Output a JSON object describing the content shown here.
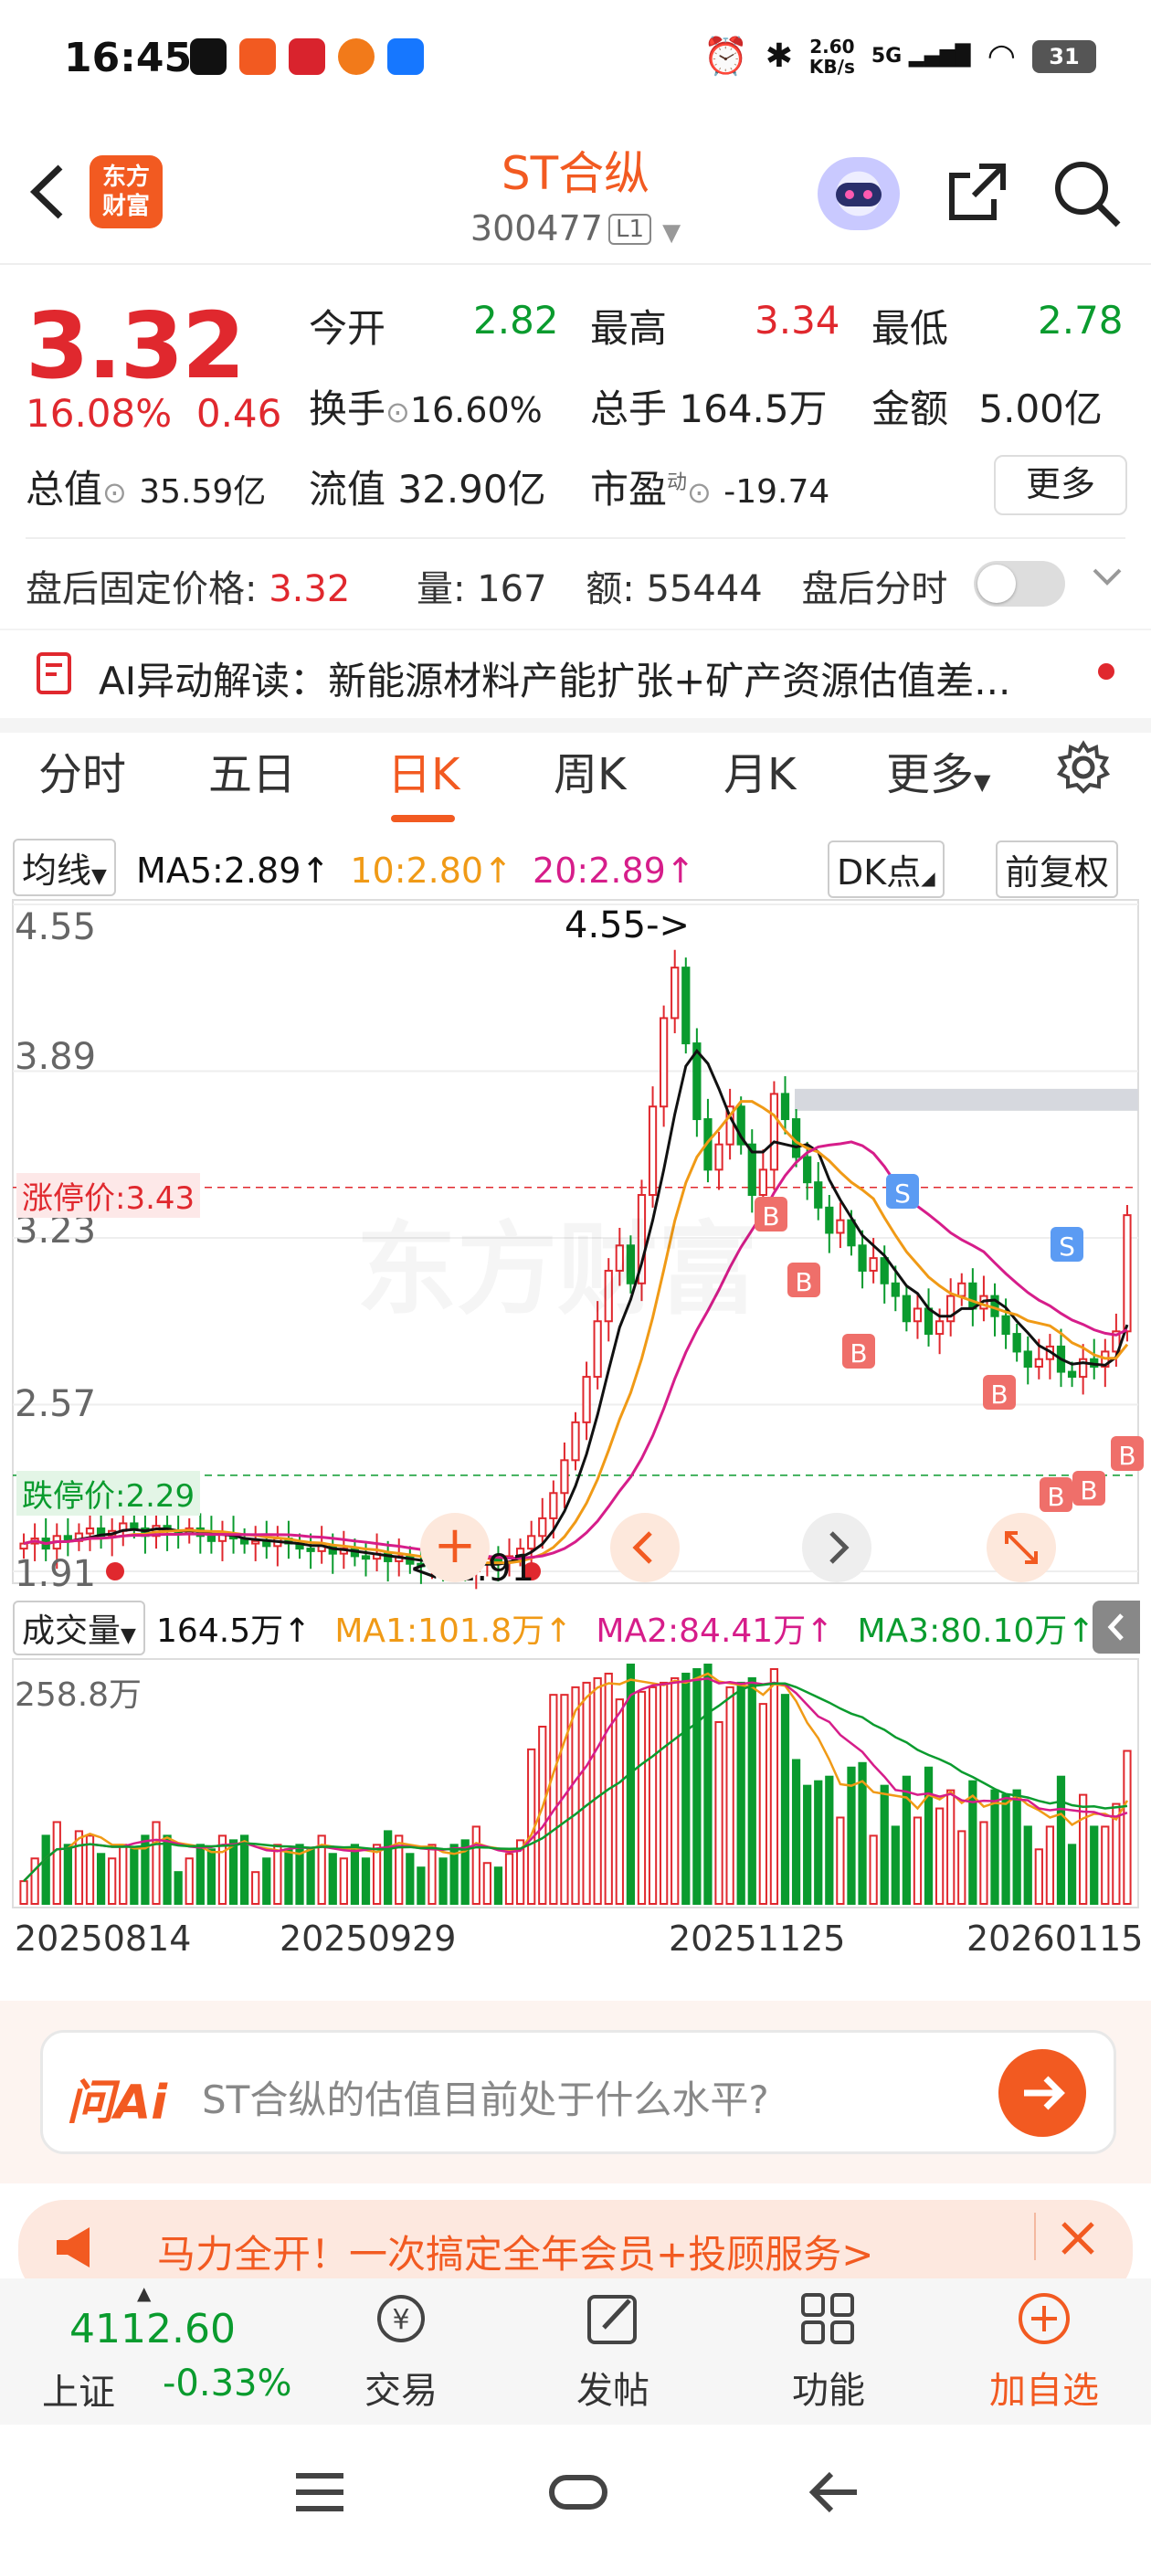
{
  "status_bar": {
    "time": "16:45",
    "net_speed_value": "2.60",
    "net_speed_unit": "KB/s",
    "signal": "5G",
    "battery": "31"
  },
  "header": {
    "logo_line1": "东方",
    "logo_line2": "财富",
    "title": "ST合纵",
    "code": "300477",
    "code_badge": "L1"
  },
  "quote": {
    "price": "3.32",
    "change_pct": "16.08%",
    "change_amt": "0.46",
    "open_label": "今开",
    "open": "2.82",
    "high_label": "最高",
    "high": "3.34",
    "low_label": "最低",
    "low": "2.78",
    "turnover_label": "换手",
    "turnover": "16.60%",
    "volume_label": "总手",
    "volume": "164.5万",
    "amount_label": "金额",
    "amount": "5.00亿",
    "mktcap_label": "总值",
    "mktcap": "35.59亿",
    "float_label": "流值",
    "float_cap": "32.90亿",
    "pe_label": "市盈",
    "pe_sup": "动",
    "pe": "-19.74",
    "more_label": "更多"
  },
  "after_hours": {
    "label": "盘后固定价格:",
    "price": "3.32",
    "vol_label": "量:",
    "vol": "167",
    "amt_label": "额:",
    "amt": "55444",
    "timeshare_label": "盘后分时"
  },
  "ai_news": {
    "text": "AI异动解读：新能源材料产能扩张+矿产资源估值差..."
  },
  "tabs": [
    {
      "label": "分时"
    },
    {
      "label": "五日"
    },
    {
      "label": "日K"
    },
    {
      "label": "周K"
    },
    {
      "label": "月K"
    },
    {
      "label": "更多"
    }
  ],
  "ma_row": {
    "selector": "均线",
    "ma5": "MA5:2.89",
    "ma10": "10:2.80",
    "ma20": "20:2.89",
    "dk": "DK点",
    "adjust": "前复权"
  },
  "chart_labels": {
    "y_455": "4.55",
    "y_389": "3.89",
    "y_323": "3.23",
    "y_257": "2.57",
    "y_191": "1.91",
    "high_marker": "4.55->",
    "low_marker": "<-1.91",
    "limit_up": "涨停价:3.43",
    "limit_down": "跌停价:2.29",
    "vol_max": "258.8万",
    "watermark": "东方财富"
  },
  "volume_row": {
    "selector": "成交量",
    "vol": "164.5万",
    "ma1": "MA1:101.8万",
    "ma2": "MA2:84.41万",
    "ma3": "MA3:80.10万"
  },
  "dates": [
    "20250814",
    "20250929",
    "20251125",
    "20260115"
  ],
  "ask": {
    "brand": "问Ai",
    "question": "ST合纵的估值目前处于什么水平?"
  },
  "banner": {
    "text": "马力全开！一次搞定全年会员+投顾服务>"
  },
  "bottom_nav": {
    "index_value": "4112.60",
    "index_name": "上证",
    "index_change": "-0.33%",
    "trade": "交易",
    "post": "发帖",
    "functions": "功能",
    "add_watch": "加自选"
  },
  "colors": {
    "accent": "#f25a21",
    "up": "#e0282e",
    "down": "#0a9b2e",
    "ma5": "#111111",
    "ma10": "#f09a16",
    "ma20": "#d61d8a"
  },
  "chart_data": {
    "type": "candlestick",
    "x_ticks": [
      "20250814",
      "20250929",
      "20251125",
      "20260115"
    ],
    "y_ticks": [
      4.55,
      3.89,
      3.23,
      2.57,
      1.91
    ],
    "ylim": [
      1.91,
      4.55
    ],
    "annotations": {
      "max": 4.55,
      "min": 1.91,
      "limit_up": 3.43,
      "limit_down": 2.29
    },
    "close": [
      2.02,
      2.04,
      2.0,
      2.05,
      2.03,
      2.06,
      2.08,
      2.05,
      2.07,
      2.1,
      2.08,
      2.05,
      2.09,
      2.07,
      2.06,
      2.08,
      2.05,
      2.03,
      2.06,
      2.04,
      2.02,
      2.03,
      2.01,
      2.04,
      2.02,
      2.0,
      1.99,
      2.01,
      1.98,
      2.0,
      1.97,
      1.96,
      1.98,
      1.95,
      1.97,
      1.94,
      1.93,
      1.96,
      1.95,
      1.93,
      1.91,
      1.94,
      1.96,
      1.95,
      1.97,
      2.0,
      2.05,
      2.12,
      2.22,
      2.35,
      2.5,
      2.68,
      2.9,
      3.1,
      3.2,
      3.05,
      3.4,
      3.75,
      4.1,
      4.3,
      4.0,
      3.7,
      3.5,
      3.6,
      3.75,
      3.6,
      3.4,
      3.5,
      3.8,
      3.7,
      3.55,
      3.45,
      3.35,
      3.25,
      3.3,
      3.2,
      3.1,
      3.15,
      3.05,
      3.0,
      2.9,
      2.95,
      2.85,
      2.9,
      3.0,
      3.05,
      2.95,
      3.0,
      2.92,
      2.85,
      2.78,
      2.72,
      2.75,
      2.8,
      2.7,
      2.68,
      2.75,
      2.72,
      2.78,
      2.86,
      3.32
    ],
    "volume_max": "258.8万",
    "volume_ma": {
      "MA1": "101.8万",
      "MA2": "84.41万",
      "MA3": "80.10万"
    },
    "ma": {
      "MA5": 2.89,
      "MA10": 2.8,
      "MA20": 2.89
    }
  }
}
